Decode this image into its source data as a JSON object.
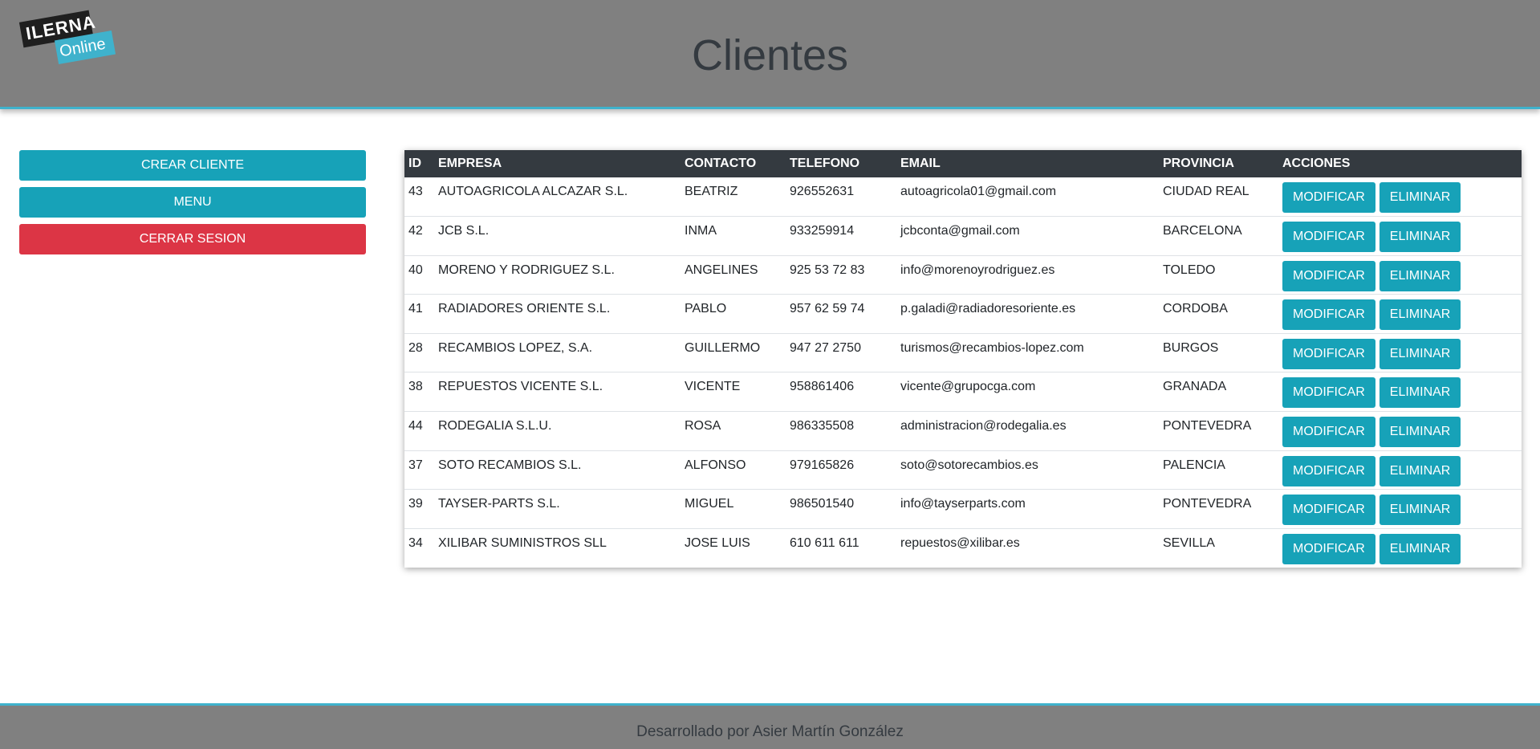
{
  "header": {
    "logo_top": "ILERNA",
    "logo_bottom": "Online",
    "title": "Clientes"
  },
  "sidebar": {
    "create_label": "CREAR CLIENTE",
    "menu_label": "MENU",
    "logout_label": "CERRAR SESION"
  },
  "table": {
    "headers": {
      "id": "ID",
      "empresa": "EMPRESA",
      "contacto": "CONTACTO",
      "telefono": "TELEFONO",
      "email": "EMAIL",
      "provincia": "PROVINCIA",
      "acciones": "ACCIONES"
    },
    "modify_label": "MODIFICAR",
    "delete_label": "ELIMINAR",
    "rows": [
      {
        "id": "43",
        "empresa": "AUTOAGRICOLA ALCAZAR S.L.",
        "contacto": "BEATRIZ",
        "telefono": "926552631",
        "email": "autoagricola01@gmail.com",
        "provincia": "CIUDAD REAL"
      },
      {
        "id": "42",
        "empresa": "JCB S.L.",
        "contacto": "INMA",
        "telefono": "933259914",
        "email": "jcbconta@gmail.com",
        "provincia": "BARCELONA"
      },
      {
        "id": "40",
        "empresa": "MORENO Y RODRIGUEZ S.L.",
        "contacto": "ANGELINES",
        "telefono": "925 53 72 83",
        "email": "info@morenoyrodriguez.es",
        "provincia": "TOLEDO"
      },
      {
        "id": "41",
        "empresa": "RADIADORES ORIENTE S.L.",
        "contacto": "PABLO",
        "telefono": "957 62 59 74",
        "email": "p.galadi@radiadoresoriente.es",
        "provincia": "CORDOBA"
      },
      {
        "id": "28",
        "empresa": "RECAMBIOS LOPEZ, S.A.",
        "contacto": "GUILLERMO",
        "telefono": "947 27 2750",
        "email": "turismos@recambios-lopez.com",
        "provincia": "BURGOS"
      },
      {
        "id": "38",
        "empresa": "REPUESTOS VICENTE S.L.",
        "contacto": "VICENTE",
        "telefono": "958861406",
        "email": "vicente@grupocga.com",
        "provincia": "GRANADA"
      },
      {
        "id": "44",
        "empresa": "RODEGALIA S.L.U.",
        "contacto": "ROSA",
        "telefono": "986335508",
        "email": "administracion@rodegalia.es",
        "provincia": "PONTEVEDRA"
      },
      {
        "id": "37",
        "empresa": "SOTO RECAMBIOS S.L.",
        "contacto": "ALFONSO",
        "telefono": "979165826",
        "email": "soto@sotorecambios.es",
        "provincia": "PALENCIA"
      },
      {
        "id": "39",
        "empresa": "TAYSER-PARTS S.L.",
        "contacto": "MIGUEL",
        "telefono": "986501540",
        "email": "info@tayserparts.com",
        "provincia": "PONTEVEDRA"
      },
      {
        "id": "34",
        "empresa": "XILIBAR SUMINISTROS SLL",
        "contacto": "JOSE LUIS",
        "telefono": "610 611 611",
        "email": "repuestos@xilibar.es",
        "provincia": "SEVILLA"
      }
    ]
  },
  "footer": {
    "text": "Desarrollado por Asier Martín González"
  },
  "colors": {
    "header_bg": "#808080",
    "accent": "#3fb2cc",
    "info_button": "#17a2b8",
    "danger_button": "#dc3545",
    "table_header": "#343a40"
  }
}
